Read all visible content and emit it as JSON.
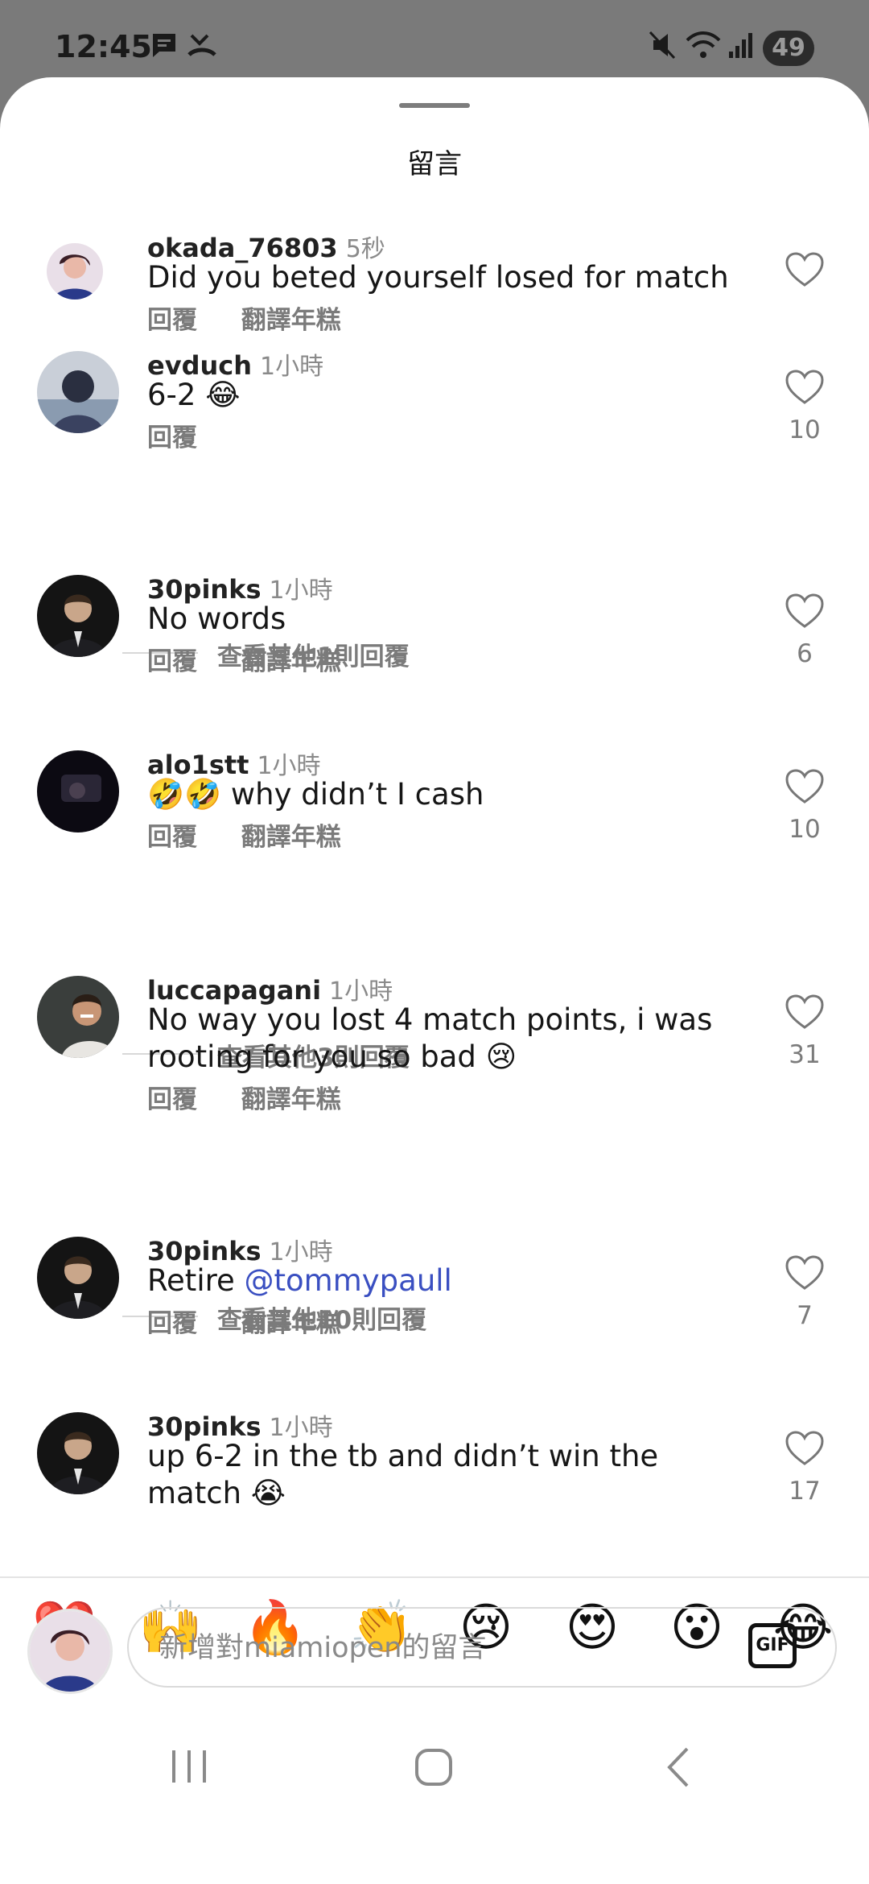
{
  "status_bar": {
    "time": "12:45",
    "battery": "49"
  },
  "sheet": {
    "title": "留言"
  },
  "comments": [
    {
      "username": "okada_76803",
      "time": "5秒",
      "text": "Did you beted yourself losed for match",
      "reply": "回覆",
      "translate": "翻譯年糕",
      "likes": ""
    },
    {
      "username": "evduch",
      "time": "1小時",
      "text": "6-2 😂",
      "reply": "回覆",
      "translate": "",
      "likes": "10",
      "view_more": "查看其他1則回覆"
    },
    {
      "username": "30pinks",
      "time": "1小時",
      "text": "No words",
      "reply": "回覆",
      "translate": "翻譯年糕",
      "likes": "6"
    },
    {
      "username": "alo1stt",
      "time": "1小時",
      "text": "🤣🤣 why didn’t I cash",
      "reply": "回覆",
      "translate": "翻譯年糕",
      "likes": "10",
      "view_more": "查看其他3則回覆"
    },
    {
      "username": "luccapagani",
      "time": "1小時",
      "text": "No way you lost 4 match points, i was rooting for you so bad 😢",
      "reply": "回覆",
      "translate": "翻譯年糕",
      "likes": "31",
      "view_more": "查看其他10則回覆"
    },
    {
      "username": "30pinks",
      "time": "1小時",
      "text_prefix": "Retire ",
      "mention": "@tommypaull",
      "reply": "回覆",
      "translate": "翻譯年糕",
      "likes": "7"
    },
    {
      "username": "30pinks",
      "time": "1小時",
      "text": "up 6-2 in the tb and didn’t win the match 😭",
      "reply": "",
      "translate": "",
      "likes": "17"
    }
  ],
  "emoji_bar": [
    "❤️",
    "🙌",
    "🔥",
    "👏",
    "😢",
    "😍",
    "😮",
    "😂"
  ],
  "composer": {
    "placeholder": "新增對miamiopen的留言",
    "gif_label": "GIF"
  },
  "colors": {
    "mention": "#3a4fc1",
    "muted": "#7b7b7b",
    "background": "#ffffff"
  }
}
